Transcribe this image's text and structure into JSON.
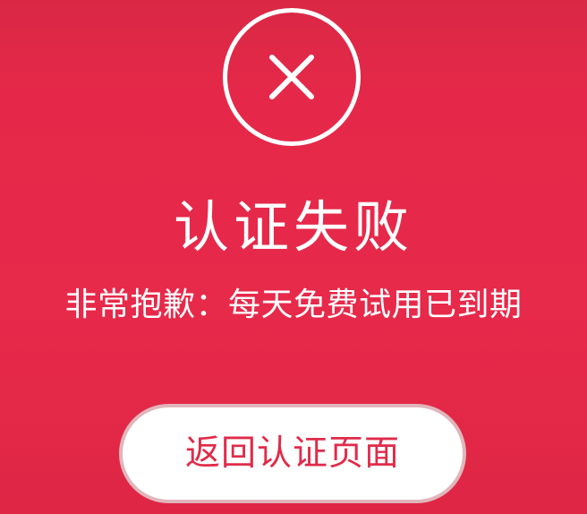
{
  "page": {
    "background_color": "#e5284a",
    "status_icon": "close-circle-icon",
    "title": "认证失败",
    "message": "非常抱歉：每天免费试用已到期",
    "return_button": {
      "label": "返回认证页面",
      "text_color": "#e02b4a",
      "background_color": "#ffffff"
    }
  }
}
